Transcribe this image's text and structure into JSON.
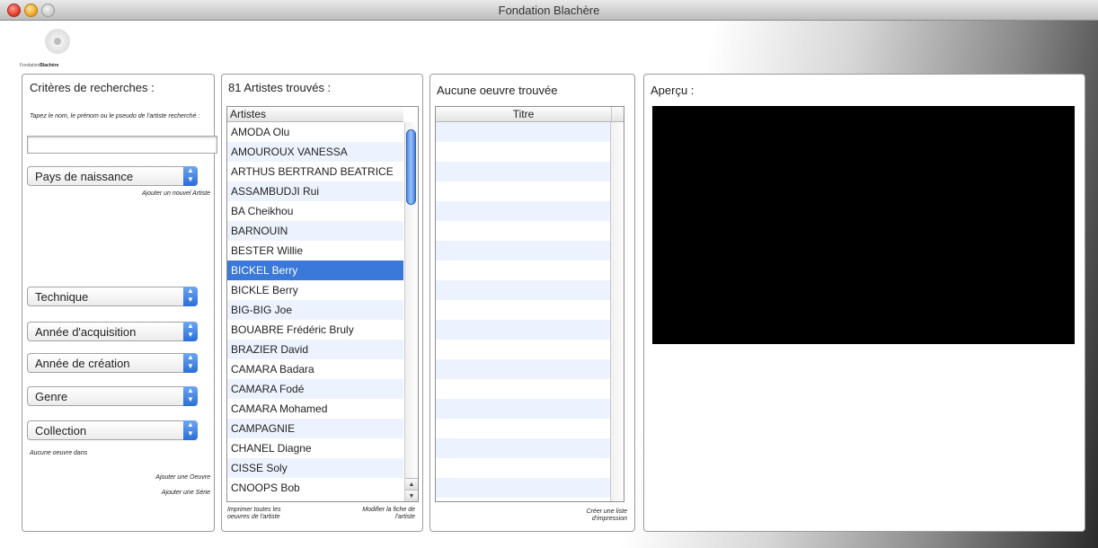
{
  "window": {
    "title": "Fondation Blachère"
  },
  "logo": {
    "prefix": "Fondation",
    "name": "Blachère"
  },
  "criteria": {
    "title": "Critères de recherches :",
    "instructions": "Tapez le nom, le prénom ou le pseudo de l'artiste recherché :",
    "search_value": "",
    "pays_label": "Pays de naissance",
    "add_artist_link": "Ajouter un nouvel Artiste",
    "technique_label": "Technique",
    "annee_acquisition_label": "Année d'acquisition",
    "annee_creation_label": "Année de création",
    "genre_label": "Genre",
    "collection_label": "Collection",
    "no_work_text": "Aucune oeuvre dans",
    "add_work_link": "Ajouter une Oeuvre",
    "add_series_link": "Ajouter une Série"
  },
  "artists": {
    "title": "81 Artistes trouvés :",
    "column_header": "Artistes",
    "items": [
      "AMODA Olu",
      "AMOUROUX VANESSA",
      "ARTHUS BERTRAND BEATRICE",
      "ASSAMBUDJI Rui",
      "BA Cheikhou",
      "BARNOUIN",
      "BESTER Willie",
      "BICKEL Berry",
      "BICKLE Berry",
      "BIG-BIG Joe",
      "BOUABRE Frédéric Bruly",
      "BRAZIER David",
      "CAMARA Badara",
      "CAMARA Fodé",
      "CAMARA Mohamed",
      "CAMPAGNIE",
      "CHANEL Diagne",
      "CISSE Soly",
      "CNOOPS Bob"
    ],
    "selected_item": "BICKEL Berry",
    "print_link": "Imprimer toutes les oeuvres de l'artiste",
    "edit_link": "Modifier la fiche de l'artiste"
  },
  "works": {
    "title": "Aucune oeuvre trouvée",
    "column_header": "Titre",
    "print_list_link": "Créer une liste d'impression"
  },
  "preview": {
    "title": "Aperçu :"
  }
}
